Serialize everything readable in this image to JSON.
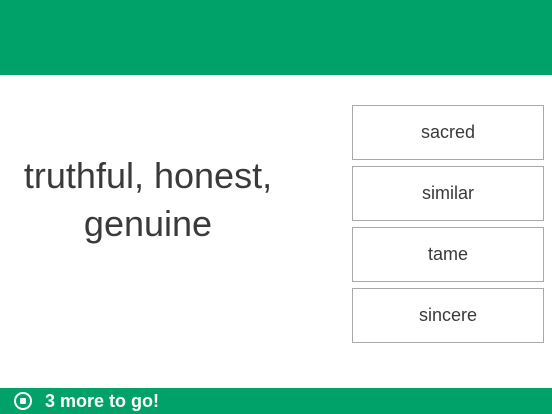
{
  "prompt": {
    "line1": "truthful, honest,",
    "line2": "genuine"
  },
  "options": [
    "sacred",
    "similar",
    "tame",
    "sincere"
  ],
  "footer": {
    "icon": "stop-circle-icon",
    "progress_text": "3 more to go!"
  },
  "colors": {
    "accent": "#00a26a",
    "text": "#3a3a3a",
    "option_border": "#a9a9a9"
  }
}
